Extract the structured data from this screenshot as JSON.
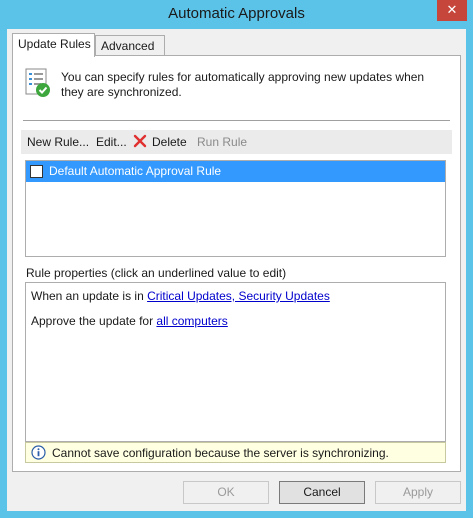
{
  "window": {
    "title": "Automatic Approvals",
    "close_glyph": "✕"
  },
  "tabs": [
    {
      "label": "Update Rules",
      "active": true
    },
    {
      "label": "Advanced",
      "active": false
    }
  ],
  "intro": {
    "icon": "rules-checklist-icon",
    "text": "You can specify rules for automatically approving new updates when they are synchronized."
  },
  "toolbar": {
    "new_rule": "New Rule...",
    "edit": "Edit...",
    "delete": "Delete",
    "run_rule": "Run Rule"
  },
  "rules": [
    {
      "label": "Default Automatic Approval Rule",
      "checked": false,
      "selected": true
    }
  ],
  "properties": {
    "label": "Rule properties (click an underlined value to edit)",
    "line1_prefix": "When an update is in ",
    "line1_link": "Critical Updates, Security Updates",
    "line2_prefix": "Approve the update for ",
    "line2_link": "all computers"
  },
  "status": {
    "icon": "info-icon",
    "text": "Cannot save configuration because the server is synchronizing."
  },
  "buttons": {
    "ok": "OK",
    "cancel": "Cancel",
    "apply": "Apply"
  },
  "colors": {
    "titlebar": "#5cc3e8",
    "close": "#c7463b",
    "selection": "#3399ff",
    "status_bg": "#ffffe1",
    "link": "#0000cc",
    "delete_icon": "#e03030"
  }
}
